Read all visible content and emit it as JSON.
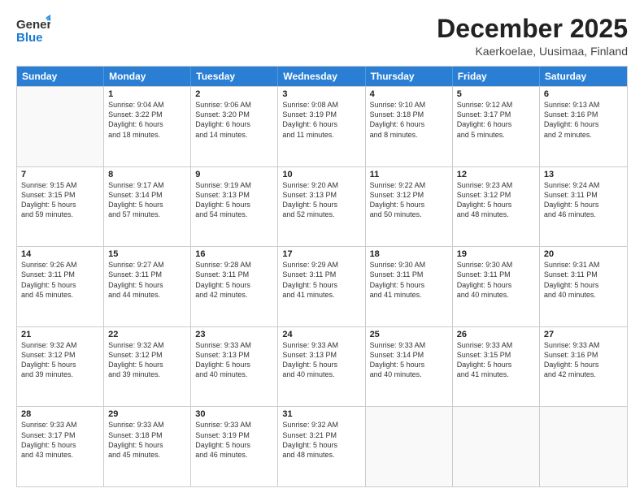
{
  "header": {
    "logo_general": "General",
    "logo_blue": "Blue",
    "month": "December 2025",
    "location": "Kaerkoelae, Uusimaa, Finland"
  },
  "weekdays": [
    "Sunday",
    "Monday",
    "Tuesday",
    "Wednesday",
    "Thursday",
    "Friday",
    "Saturday"
  ],
  "weeks": [
    [
      {
        "day": "",
        "info": ""
      },
      {
        "day": "1",
        "info": "Sunrise: 9:04 AM\nSunset: 3:22 PM\nDaylight: 6 hours\nand 18 minutes."
      },
      {
        "day": "2",
        "info": "Sunrise: 9:06 AM\nSunset: 3:20 PM\nDaylight: 6 hours\nand 14 minutes."
      },
      {
        "day": "3",
        "info": "Sunrise: 9:08 AM\nSunset: 3:19 PM\nDaylight: 6 hours\nand 11 minutes."
      },
      {
        "day": "4",
        "info": "Sunrise: 9:10 AM\nSunset: 3:18 PM\nDaylight: 6 hours\nand 8 minutes."
      },
      {
        "day": "5",
        "info": "Sunrise: 9:12 AM\nSunset: 3:17 PM\nDaylight: 6 hours\nand 5 minutes."
      },
      {
        "day": "6",
        "info": "Sunrise: 9:13 AM\nSunset: 3:16 PM\nDaylight: 6 hours\nand 2 minutes."
      }
    ],
    [
      {
        "day": "7",
        "info": "Sunrise: 9:15 AM\nSunset: 3:15 PM\nDaylight: 5 hours\nand 59 minutes."
      },
      {
        "day": "8",
        "info": "Sunrise: 9:17 AM\nSunset: 3:14 PM\nDaylight: 5 hours\nand 57 minutes."
      },
      {
        "day": "9",
        "info": "Sunrise: 9:19 AM\nSunset: 3:13 PM\nDaylight: 5 hours\nand 54 minutes."
      },
      {
        "day": "10",
        "info": "Sunrise: 9:20 AM\nSunset: 3:13 PM\nDaylight: 5 hours\nand 52 minutes."
      },
      {
        "day": "11",
        "info": "Sunrise: 9:22 AM\nSunset: 3:12 PM\nDaylight: 5 hours\nand 50 minutes."
      },
      {
        "day": "12",
        "info": "Sunrise: 9:23 AM\nSunset: 3:12 PM\nDaylight: 5 hours\nand 48 minutes."
      },
      {
        "day": "13",
        "info": "Sunrise: 9:24 AM\nSunset: 3:11 PM\nDaylight: 5 hours\nand 46 minutes."
      }
    ],
    [
      {
        "day": "14",
        "info": "Sunrise: 9:26 AM\nSunset: 3:11 PM\nDaylight: 5 hours\nand 45 minutes."
      },
      {
        "day": "15",
        "info": "Sunrise: 9:27 AM\nSunset: 3:11 PM\nDaylight: 5 hours\nand 44 minutes."
      },
      {
        "day": "16",
        "info": "Sunrise: 9:28 AM\nSunset: 3:11 PM\nDaylight: 5 hours\nand 42 minutes."
      },
      {
        "day": "17",
        "info": "Sunrise: 9:29 AM\nSunset: 3:11 PM\nDaylight: 5 hours\nand 41 minutes."
      },
      {
        "day": "18",
        "info": "Sunrise: 9:30 AM\nSunset: 3:11 PM\nDaylight: 5 hours\nand 41 minutes."
      },
      {
        "day": "19",
        "info": "Sunrise: 9:30 AM\nSunset: 3:11 PM\nDaylight: 5 hours\nand 40 minutes."
      },
      {
        "day": "20",
        "info": "Sunrise: 9:31 AM\nSunset: 3:11 PM\nDaylight: 5 hours\nand 40 minutes."
      }
    ],
    [
      {
        "day": "21",
        "info": "Sunrise: 9:32 AM\nSunset: 3:12 PM\nDaylight: 5 hours\nand 39 minutes."
      },
      {
        "day": "22",
        "info": "Sunrise: 9:32 AM\nSunset: 3:12 PM\nDaylight: 5 hours\nand 39 minutes."
      },
      {
        "day": "23",
        "info": "Sunrise: 9:33 AM\nSunset: 3:13 PM\nDaylight: 5 hours\nand 40 minutes."
      },
      {
        "day": "24",
        "info": "Sunrise: 9:33 AM\nSunset: 3:13 PM\nDaylight: 5 hours\nand 40 minutes."
      },
      {
        "day": "25",
        "info": "Sunrise: 9:33 AM\nSunset: 3:14 PM\nDaylight: 5 hours\nand 40 minutes."
      },
      {
        "day": "26",
        "info": "Sunrise: 9:33 AM\nSunset: 3:15 PM\nDaylight: 5 hours\nand 41 minutes."
      },
      {
        "day": "27",
        "info": "Sunrise: 9:33 AM\nSunset: 3:16 PM\nDaylight: 5 hours\nand 42 minutes."
      }
    ],
    [
      {
        "day": "28",
        "info": "Sunrise: 9:33 AM\nSunset: 3:17 PM\nDaylight: 5 hours\nand 43 minutes."
      },
      {
        "day": "29",
        "info": "Sunrise: 9:33 AM\nSunset: 3:18 PM\nDaylight: 5 hours\nand 45 minutes."
      },
      {
        "day": "30",
        "info": "Sunrise: 9:33 AM\nSunset: 3:19 PM\nDaylight: 5 hours\nand 46 minutes."
      },
      {
        "day": "31",
        "info": "Sunrise: 9:32 AM\nSunset: 3:21 PM\nDaylight: 5 hours\nand 48 minutes."
      },
      {
        "day": "",
        "info": ""
      },
      {
        "day": "",
        "info": ""
      },
      {
        "day": "",
        "info": ""
      }
    ]
  ]
}
